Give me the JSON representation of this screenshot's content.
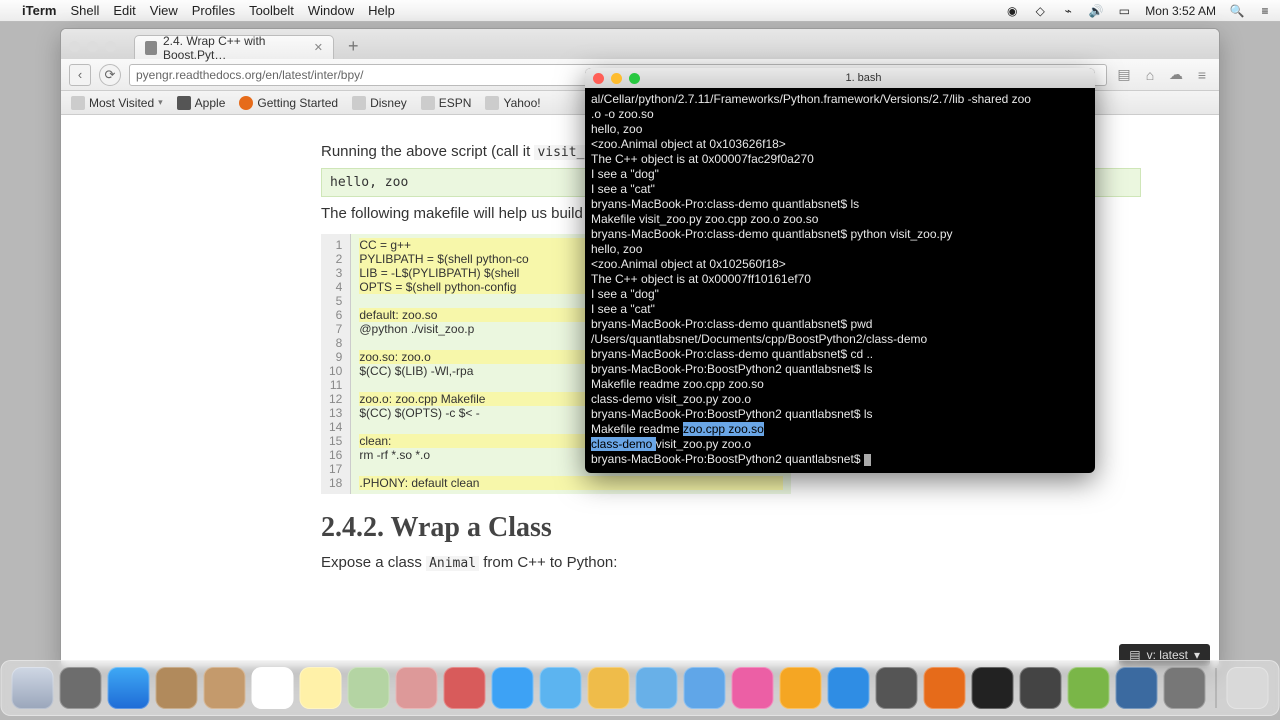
{
  "menu": {
    "app": "iTerm",
    "items": [
      "Shell",
      "Edit",
      "View",
      "Profiles",
      "Toolbelt",
      "Window",
      "Help"
    ],
    "clock": "Mon 3:52 AM"
  },
  "browser": {
    "tab_title": "2.4. Wrap C++ with Boost.Pyt…",
    "url": "pyengr.readthedocs.org/en/latest/inter/bpy/",
    "bookmarks": [
      "Most Visited",
      "Apple",
      "Getting Started",
      "Disney",
      "ESPN",
      "Yahoo!"
    ]
  },
  "page": {
    "p1_a": "Running the above script (call it ",
    "p1_code": "visit_zo",
    "pre1": "hello, zoo",
    "p2": "The following makefile will help us build",
    "linenos": [
      "1",
      "2",
      "3",
      "4",
      "5",
      "6",
      "7",
      "8",
      "9",
      "10",
      "11",
      "12",
      "13",
      "14",
      "15",
      "16",
      "17",
      "18"
    ],
    "code": [
      "CC = g++",
      "PYLIBPATH = $(shell python-co",
      "LIB = -L$(PYLIBPATH) $(shell ",
      "OPTS = $(shell python-config ",
      "",
      "default: zoo.so",
      "        @python ./visit_zoo.p",
      "",
      "zoo.so: zoo.o",
      "        $(CC) $(LIB) -Wl,-rpa",
      "",
      "zoo.o: zoo.cpp Makefile",
      "        $(CC) $(OPTS) -c $< -",
      "",
      "clean:",
      "        rm -rf *.so *.o",
      "",
      ".PHONY: default clean"
    ],
    "h2": "2.4.2. Wrap a Class",
    "p3_a": "Expose a class ",
    "p3_code": "Animal",
    "p3_b": " from C++ to Python:"
  },
  "term": {
    "title": "1. bash",
    "lines": [
      "al/Cellar/python/2.7.11/Frameworks/Python.framework/Versions/2.7/lib -shared zoo",
      ".o -o zoo.so",
      "hello, zoo",
      "<zoo.Animal object at 0x103626f18>",
      "The C++ object is at 0x00007fac29f0a270",
      "I see a \"dog\"",
      "I see a \"cat\"",
      "bryans-MacBook-Pro:class-demo quantlabsnet$ ls",
      "Makefile        visit_zoo.py    zoo.cpp         zoo.o           zoo.so",
      "bryans-MacBook-Pro:class-demo quantlabsnet$ python visit_zoo.py",
      "hello, zoo",
      "<zoo.Animal object at 0x102560f18>",
      "The C++ object is at 0x00007ff10161ef70",
      "I see a \"dog\"",
      "I see a \"cat\"",
      "bryans-MacBook-Pro:class-demo quantlabsnet$ pwd",
      "/Users/quantlabsnet/Documents/cpp/BoostPython2/class-demo",
      "bryans-MacBook-Pro:class-demo quantlabsnet$ cd ..",
      "bryans-MacBook-Pro:BoostPython2 quantlabsnet$ ls",
      "Makefile        readme          zoo.cpp         zoo.so",
      "class-demo      visit_zoo.py    zoo.o",
      "bryans-MacBook-Pro:BoostPython2 quantlabsnet$ ls"
    ],
    "sel_line1": {
      "pre": "Makefile        readme       ",
      "sel": "   zoo.cpp         zoo.so            "
    },
    "sel_line2": {
      "sel": "class-demo      ",
      "post": "visit_zoo.py    zoo.o"
    },
    "prompt": "bryans-MacBook-Pro:BoostPython2 quantlabsnet$ "
  },
  "version": "v: latest"
}
